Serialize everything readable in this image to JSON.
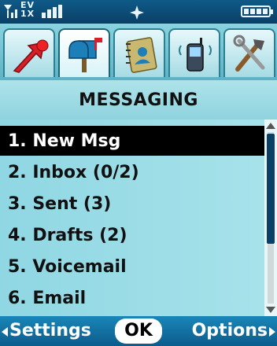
{
  "status_bar": {
    "network_line1": "EV",
    "network_line2": "1X",
    "signal_icon": "signal-bars-icon",
    "center_icon": "location-crosshair-icon",
    "battery_icon": "battery-full-icon"
  },
  "tabs": [
    {
      "icon": "new-message-arrow-icon",
      "active": false
    },
    {
      "icon": "mailbox-icon",
      "active": true
    },
    {
      "icon": "contacts-book-icon",
      "active": false
    },
    {
      "icon": "mobile-web-phone-icon",
      "active": false
    },
    {
      "icon": "settings-tools-icon",
      "active": false
    }
  ],
  "screen_title": "MESSAGING",
  "menu": {
    "selected_index": 0,
    "items": [
      {
        "label": "1. New Msg"
      },
      {
        "label": "2. Inbox (0/2)"
      },
      {
        "label": "3. Sent (3)"
      },
      {
        "label": "4. Drafts (2)"
      },
      {
        "label": "5. Voicemail"
      },
      {
        "label": "6. Email"
      }
    ]
  },
  "softkeys": {
    "left": "Settings",
    "center": "OK",
    "right": "Options"
  },
  "colors": {
    "status_bar": "#0a3f66",
    "tab_bar": "#5fb2c4",
    "menu_bg": "#9adbe6",
    "selection": "#000000",
    "softkey_bar": "#0b5c8c"
  }
}
